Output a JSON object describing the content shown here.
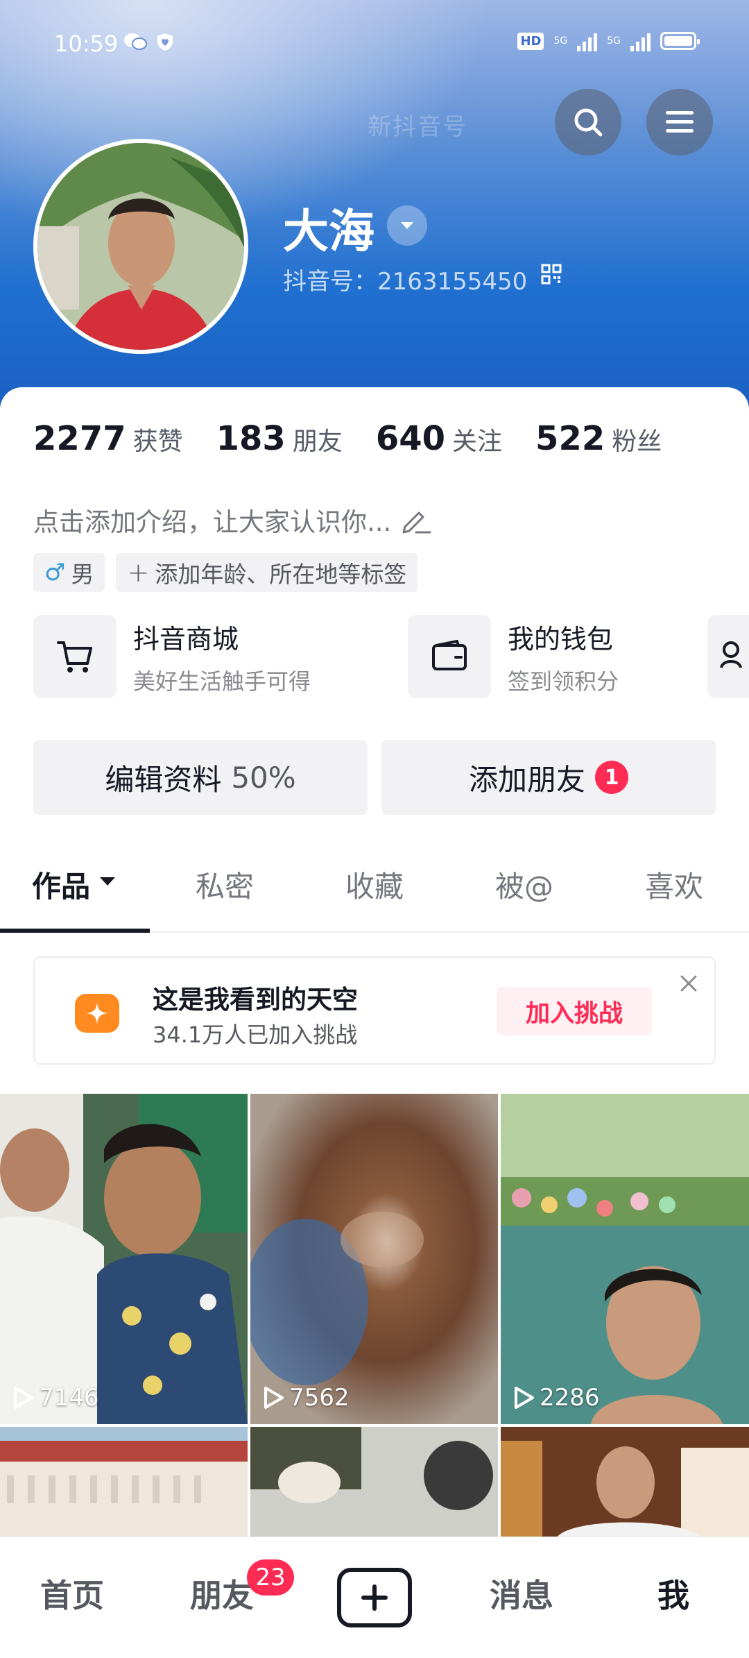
{
  "status_bar": {
    "time": "10:59",
    "hd": "HD",
    "sig1": "5G",
    "sig2": "5G"
  },
  "header": {
    "watermark": "新抖音号"
  },
  "profile": {
    "name": "大海",
    "douyin_id": "抖音号：2163155450"
  },
  "stats": [
    {
      "num": "2277",
      "label": "获赞"
    },
    {
      "num": "183",
      "label": "朋友"
    },
    {
      "num": "640",
      "label": "关注"
    },
    {
      "num": "522",
      "label": "粉丝"
    }
  ],
  "bio": "点击添加介绍，让大家认识你...",
  "tags": {
    "gender": "男",
    "add": "添加年龄、所在地等标签"
  },
  "services": [
    {
      "title": "抖音商城",
      "sub": "美好生活触手可得",
      "icon": "cart-icon"
    },
    {
      "title": "我的钱包",
      "sub": "签到领积分",
      "icon": "wallet-icon"
    }
  ],
  "actions": {
    "edit_label": "编辑资料",
    "edit_percent": "50%",
    "add_friend": "添加朋友",
    "add_friend_badge": "1"
  },
  "tabs": [
    "作品",
    "私密",
    "收藏",
    "被@",
    "喜欢"
  ],
  "challenge": {
    "title": "这是我看到的天空",
    "sub": "34.1万人已加入挑战",
    "button": "加入挑战"
  },
  "videos": [
    {
      "views": "7146"
    },
    {
      "views": "7562"
    },
    {
      "views": "2286"
    }
  ],
  "nav": {
    "home": "首页",
    "friends": "朋友",
    "friends_badge": "23",
    "messages": "消息",
    "me": "我"
  },
  "colors": {
    "accent": "#fe2c55",
    "header_blue": "#1f6fd0",
    "challenge_orange": "#ff8a1f"
  }
}
